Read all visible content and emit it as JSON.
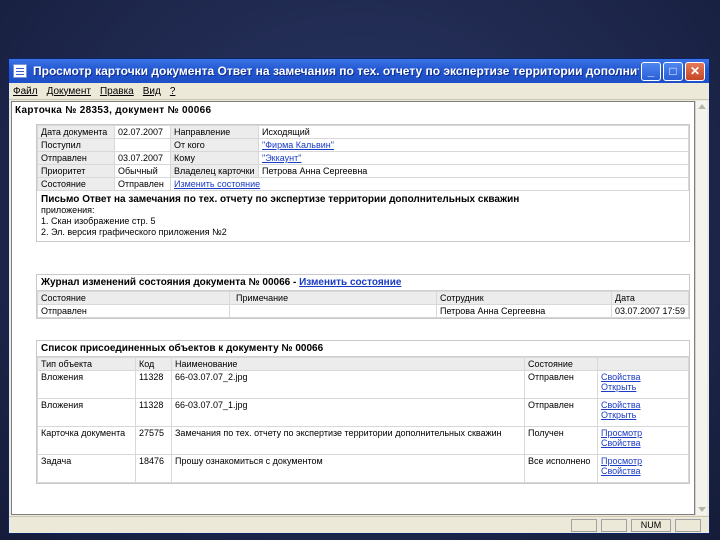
{
  "window": {
    "title": "Просмотр карточки документа Ответ на замечания по тех. отчету по экспертизе территории дополнительн...",
    "minimize": "_",
    "maximize": "□",
    "close": "✕"
  },
  "menu": [
    "Файл",
    "Документ",
    "Правка",
    "Вид",
    "?"
  ],
  "card_header": "Карточка № 28353, документ № 00066",
  "details": {
    "rows": [
      [
        "Дата документа",
        "02.07.2007",
        "Направление",
        "Исходящий"
      ],
      [
        "Поступил",
        "",
        "От кого",
        "\"Фирма Кальвин\""
      ],
      [
        "Отправлен",
        "03.07.2007",
        "Кому",
        "\"Эккаунт\""
      ],
      [
        "Приоритет",
        "Обычный",
        "Владелец карточки",
        "Петрова Анна Сергеевна"
      ],
      [
        "Состояние",
        "Отправлен",
        "Изменить состояние",
        ""
      ]
    ]
  },
  "letter": {
    "title": "Письмо Ответ на замечания по тех. отчету по экспертизе территории дополнительных скважин",
    "lines": [
      "приложения:",
      "1. Скан изображение стр. 5",
      "2. Эл. версия графического приложения №2"
    ]
  },
  "journal": {
    "header": "Журнал изменений состояния документа № 00066 -",
    "header_link": "Изменить состояние",
    "columns": [
      "Состояние",
      "Примечание",
      "Сотрудник",
      "Дата"
    ],
    "rows": [
      [
        "Отправлен",
        "",
        "Петрова Анна Сергеевна",
        "03.07.2007 17:59"
      ]
    ]
  },
  "attachments": {
    "header": "Список присоединенных объектов к документу № 00066",
    "columns": [
      "Тип объекта",
      "Код",
      "Наименование",
      "Состояние",
      ""
    ],
    "rows": [
      {
        "type": "Вложения",
        "code": "11328",
        "name": "66-03.07.07_2.jpg",
        "state": "Отправлен",
        "actions": [
          "Свойства",
          "Открыть"
        ]
      },
      {
        "type": "Вложения",
        "code": "11328",
        "name": "66-03.07.07_1.jpg",
        "state": "Отправлен",
        "actions": [
          "Свойства",
          "Открыть"
        ]
      },
      {
        "type": "Карточка документа",
        "code": "27575",
        "name": "Замечания по тех. отчету по экспертизе территории дополнительных скважин",
        "state": "Получен",
        "actions": [
          "Просмотр",
          "Свойства"
        ]
      },
      {
        "type": "Задача",
        "code": "18476",
        "name": "Прошу ознакомиться с документом",
        "state": "Все исполнено",
        "actions": [
          "Просмотр",
          "Свойства"
        ]
      }
    ]
  },
  "status": {
    "cells": [
      "",
      "",
      "NUM",
      ""
    ]
  }
}
